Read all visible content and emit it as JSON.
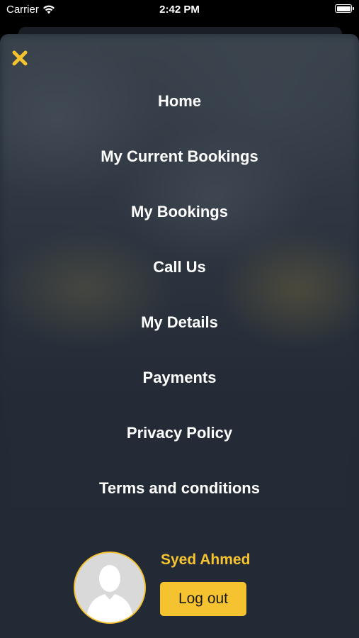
{
  "status_bar": {
    "carrier": "Carrier",
    "time": "2:42 PM",
    "wifi_icon": "wifi-icon",
    "battery_icon": "battery-icon"
  },
  "drawer": {
    "close_icon": "close-icon",
    "menu": [
      {
        "label": "Home"
      },
      {
        "label": "My Current Bookings"
      },
      {
        "label": "My Bookings"
      },
      {
        "label": "Call Us"
      },
      {
        "label": "My Details"
      },
      {
        "label": "Payments"
      },
      {
        "label": "Privacy Policy"
      },
      {
        "label": "Terms and conditions"
      }
    ]
  },
  "profile": {
    "name": "Syed Ahmed",
    "logout_label": "Log out",
    "avatar_icon": "avatar-placeholder-icon"
  },
  "colors": {
    "accent": "#F5C230",
    "background": "#222A35",
    "text": "#FFFFFF"
  }
}
